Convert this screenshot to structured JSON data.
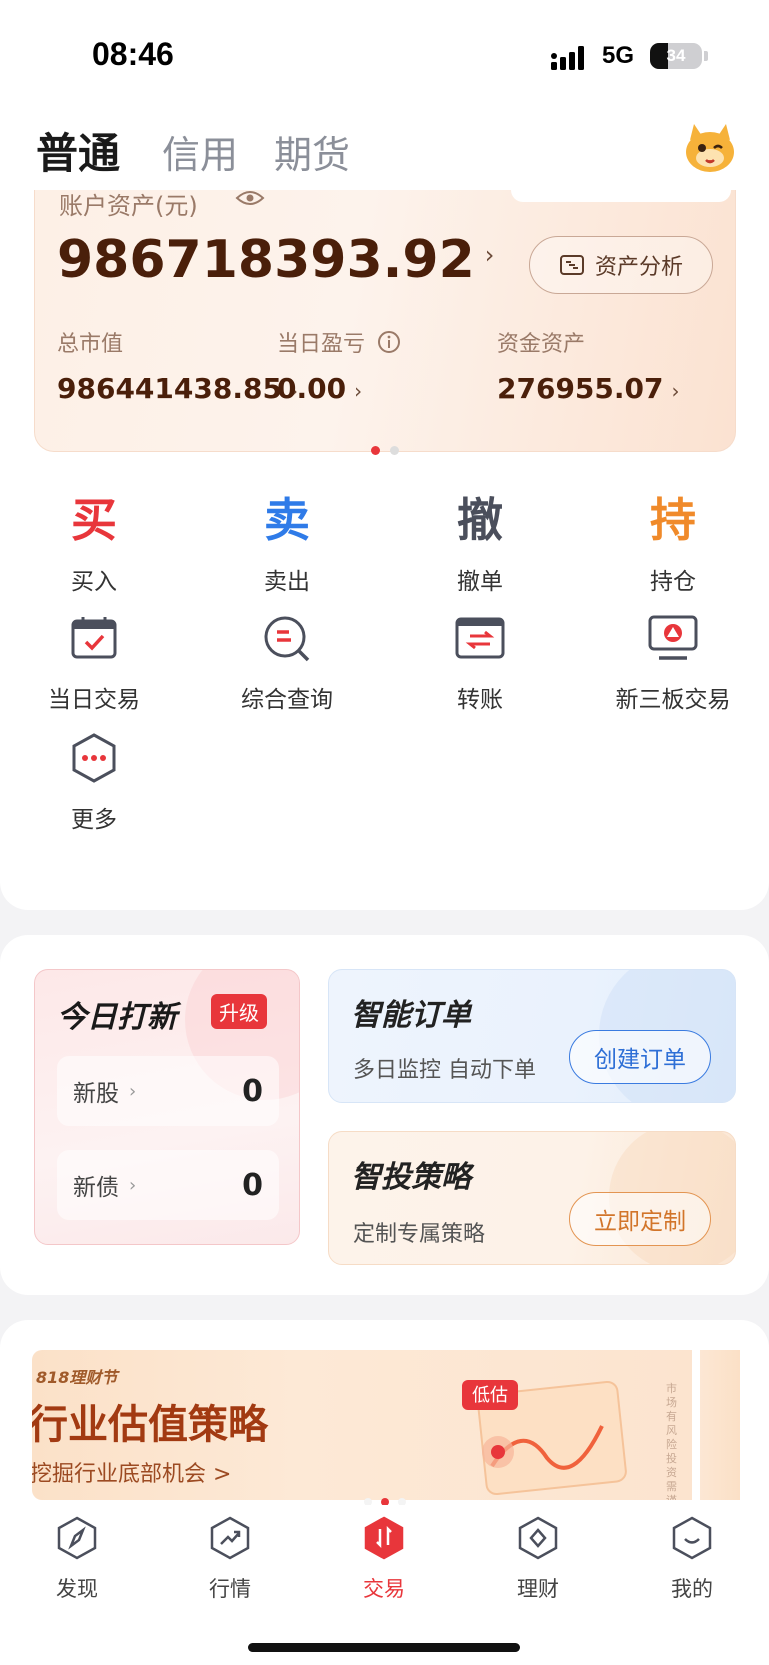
{
  "status_bar": {
    "time": "08:46",
    "network": "5G",
    "battery": "34",
    "battery_level": 0.34
  },
  "header": {
    "tabs": [
      {
        "label": "普通",
        "active": true
      },
      {
        "label": "信用",
        "active": false
      },
      {
        "label": "期货",
        "active": false
      }
    ]
  },
  "asset_card": {
    "label": "账户资产(元)",
    "total": "986718393.92",
    "analysis_button": "资产分析",
    "stats": [
      {
        "label": "总市值",
        "value": "986441438.85"
      },
      {
        "label": "当日盈亏",
        "value": "0.00"
      },
      {
        "label": "资金资产",
        "value": "276955.07"
      }
    ]
  },
  "actions": {
    "trade": [
      {
        "char": "买",
        "label": "买入",
        "color": "#e8363b"
      },
      {
        "char": "卖",
        "label": "卖出",
        "color": "#2f7be8"
      },
      {
        "char": "撤",
        "label": "撤单",
        "color": "#4b4f5c"
      },
      {
        "char": "持",
        "label": "持仓",
        "color": "#f08a2a"
      }
    ],
    "tools": [
      {
        "label": "当日交易",
        "icon": "calendar-check-icon"
      },
      {
        "label": "综合查询",
        "icon": "search-query-icon"
      },
      {
        "label": "转账",
        "icon": "transfer-icon"
      },
      {
        "label": "新三板交易",
        "icon": "monitor-icon"
      },
      {
        "label": "更多",
        "icon": "more-hexagon-icon"
      }
    ]
  },
  "ipo": {
    "title": "今日打新",
    "badge": "升级",
    "rows": [
      {
        "name": "新股",
        "count": "0"
      },
      {
        "name": "新债",
        "count": "0"
      }
    ]
  },
  "smart_order": {
    "title": "智能订单",
    "subtitle": "多日监控 自动下单",
    "button": "创建订单"
  },
  "strategy": {
    "title": "智投策略",
    "subtitle": "定制专属策略",
    "button": "立即定制"
  },
  "banner": {
    "tag": "818理财节",
    "title": "行业估值策略",
    "subtitle": "挖掘行业底部机会 >",
    "badge": "低估",
    "side_text": "市场有风险 投资需谨慎"
  },
  "bottom_nav": [
    {
      "label": "发现",
      "icon": "compass-icon",
      "active": false
    },
    {
      "label": "行情",
      "icon": "trend-icon",
      "active": false
    },
    {
      "label": "交易",
      "icon": "trade-icon",
      "active": true
    },
    {
      "label": "理财",
      "icon": "wealth-icon",
      "active": false
    },
    {
      "label": "我的",
      "icon": "profile-icon",
      "active": false
    }
  ],
  "colors": {
    "accent": "#e8363b",
    "asset_text": "#4a1f0a",
    "blue": "#2f7be8",
    "orange": "#f08a2a"
  }
}
